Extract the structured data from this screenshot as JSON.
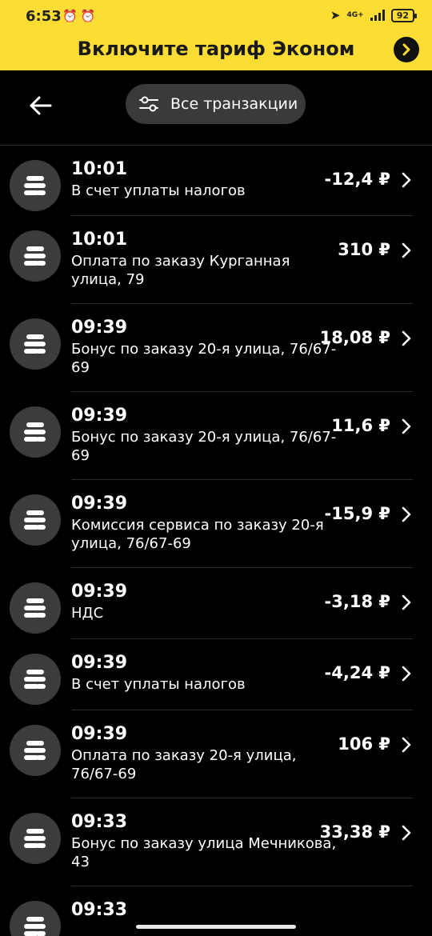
{
  "status_bar": {
    "time": "6:53",
    "network": "4G+",
    "battery": "92"
  },
  "banner": {
    "text": "Включите тариф Эконом"
  },
  "header": {
    "filter_label": "Все транзакции"
  },
  "transactions": [
    {
      "time": "10:01",
      "description": "В счет уплаты налогов",
      "amount": "-12,4 ₽"
    },
    {
      "time": "10:01",
      "description": "Оплата по заказу Курганная улица, 79",
      "amount": "310 ₽"
    },
    {
      "time": "09:39",
      "description": "Бонус по заказу 20-я улица, 76/67-69",
      "amount": "18,08 ₽"
    },
    {
      "time": "09:39",
      "description": "Бонус по заказу 20-я улица, 76/67-69",
      "amount": "11,6 ₽"
    },
    {
      "time": "09:39",
      "description": "Комиссия сервиса по заказу 20-я улица, 76/67-69",
      "amount": "-15,9 ₽"
    },
    {
      "time": "09:39",
      "description": "НДС",
      "amount": "-3,18 ₽"
    },
    {
      "time": "09:39",
      "description": "В счет уплаты налогов",
      "amount": "-4,24 ₽"
    },
    {
      "time": "09:39",
      "description": "Оплата по заказу 20-я улица, 76/67-69",
      "amount": "106 ₽"
    },
    {
      "time": "09:33",
      "description": "Бонус по заказу улица Мечникова, 43",
      "amount": "33,38 ₽"
    },
    {
      "time": "09:33",
      "description": "",
      "amount": ""
    }
  ],
  "colors": {
    "banner": "#fddc33",
    "background": "#000000",
    "pill": "#3a3a3a",
    "avatar": "#3c3c3c"
  },
  "icons": {
    "back": "arrow-left-icon",
    "filter": "sliders-icon",
    "transaction": "coins-stack-icon",
    "row_action": "chevron-right-icon",
    "banner_action": "chevron-right-icon"
  }
}
